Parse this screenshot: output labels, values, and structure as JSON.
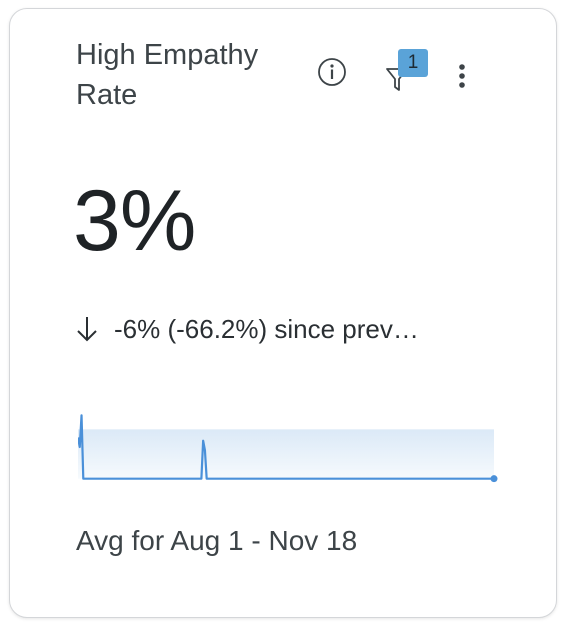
{
  "card": {
    "title": "High Empathy Rate",
    "value": "3%",
    "delta": {
      "direction": "down",
      "text": "-6% (-66.2%) since prev…"
    },
    "filter_count": "1",
    "footer": "Avg for Aug 1 - Nov 18",
    "icons": {
      "info": "info-circle-icon",
      "filter": "filter-funnel-icon",
      "more": "vertical-ellipsis-icon",
      "arrow": "arrow-down-icon"
    }
  },
  "chart_data": {
    "type": "area",
    "color": "#4a90d9",
    "fill_top": "#dbe9f7",
    "fill_bottom": "#f6fafd",
    "values": [
      15,
      12,
      22,
      2,
      2,
      2,
      2,
      2,
      2,
      2,
      2,
      2,
      2,
      2,
      2,
      2,
      2,
      2,
      2,
      2,
      2,
      2,
      2,
      2,
      2,
      2,
      2,
      2,
      2,
      2,
      2,
      2,
      2,
      2,
      2,
      2,
      2,
      2,
      2,
      2,
      2,
      2,
      2,
      2,
      2,
      2,
      2,
      2,
      2,
      2,
      2,
      2,
      2,
      2,
      2,
      2,
      2,
      2,
      2,
      2,
      2,
      2,
      2,
      2,
      2,
      2,
      2,
      2,
      2,
      2,
      2,
      14,
      11,
      2,
      2,
      2,
      2,
      2,
      2,
      2,
      2,
      2,
      2,
      2,
      2,
      2,
      2,
      2,
      2,
      2,
      2,
      2,
      2,
      2,
      2,
      2,
      2,
      2,
      2,
      2,
      2,
      2,
      2,
      2,
      2,
      2,
      2,
      2,
      2,
      2,
      2,
      2,
      2,
      2,
      2,
      2,
      2,
      2,
      2,
      2,
      2,
      2,
      2,
      2,
      2,
      2,
      2,
      2,
      2,
      2,
      2,
      2,
      2,
      2,
      2,
      2,
      2,
      2,
      2,
      2,
      2,
      2,
      2,
      2,
      2,
      2,
      2,
      2,
      2,
      2,
      2,
      2,
      2,
      2,
      2,
      2,
      2,
      2,
      2,
      2,
      2,
      2,
      2,
      2,
      2,
      2,
      2,
      2,
      2,
      2,
      2,
      2,
      2,
      2,
      2,
      2,
      2,
      2,
      2,
      2,
      2,
      2,
      2,
      2,
      2,
      2,
      2,
      2,
      2,
      2,
      2,
      2,
      2,
      2,
      2,
      2,
      2,
      2,
      2,
      2,
      2,
      2,
      2,
      2,
      2,
      2,
      2,
      2,
      2,
      2,
      2,
      2,
      2,
      2,
      2,
      2,
      2,
      2,
      2,
      2,
      2,
      2,
      2,
      2,
      2,
      2,
      2,
      2,
      2,
      2,
      2,
      2,
      2,
      2,
      2,
      2,
      2
    ],
    "ylim": [
      0,
      24
    ],
    "end_marker": true
  }
}
